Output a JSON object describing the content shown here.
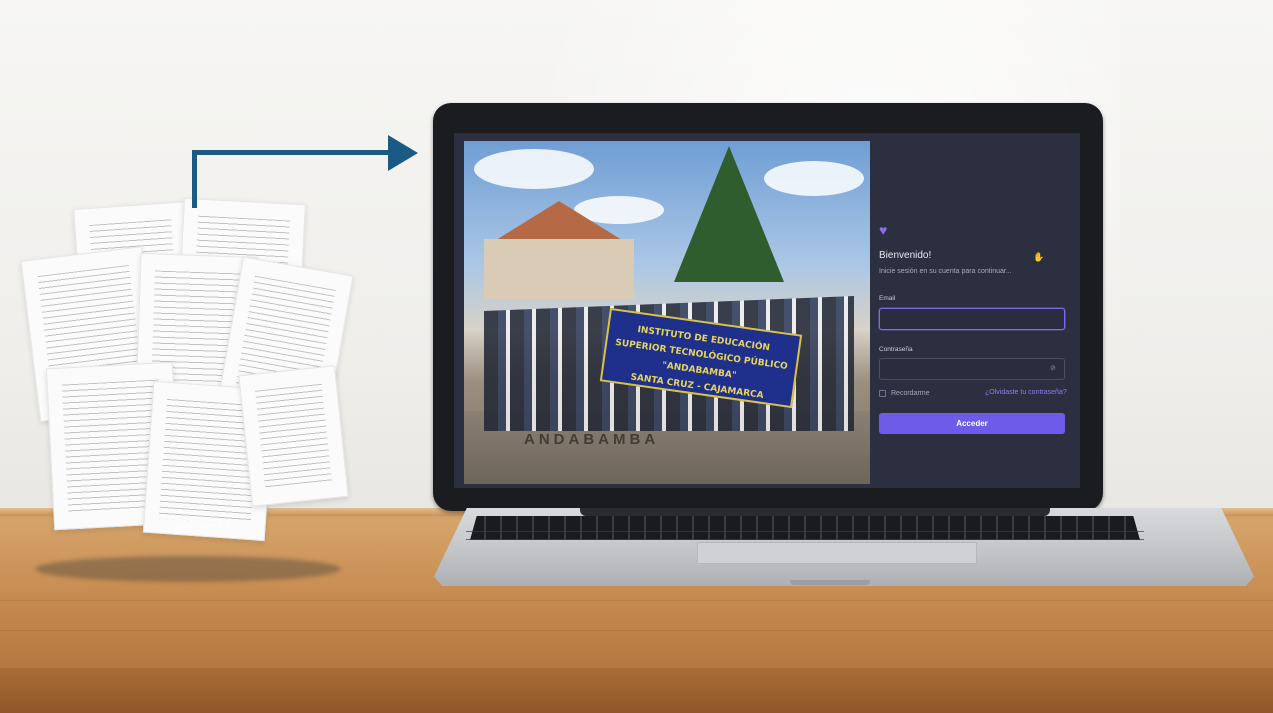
{
  "scene": {
    "banner": {
      "line1": "INSTITUTO DE EDUCACIÓN SUPERIOR TECNOLÓGICO PÚBLICO",
      "line2": "\"ANDABAMBA\"",
      "line3": "SANTA CRUZ - CAJAMARCA"
    },
    "plaza_text": "ANDABAMBA"
  },
  "login": {
    "logo_icon": "heart-icon",
    "welcome": "Bienvenido!",
    "wave_icon": "waving-hand-icon",
    "subtitle": "Inicie sesión en su cuenta para continuar...",
    "email_label": "Email",
    "email_value": "",
    "password_label": "Contraseña",
    "password_value": "",
    "password_toggle_icon": "eye-off-icon",
    "remember_label": "Recordarme",
    "forgot_link": "¿Olvidaste tu contraseña?",
    "submit_label": "Acceder"
  },
  "colors": {
    "arrow": "#1c5a86",
    "panel_bg": "#2c2f3f",
    "accent": "#6c5ce7"
  }
}
